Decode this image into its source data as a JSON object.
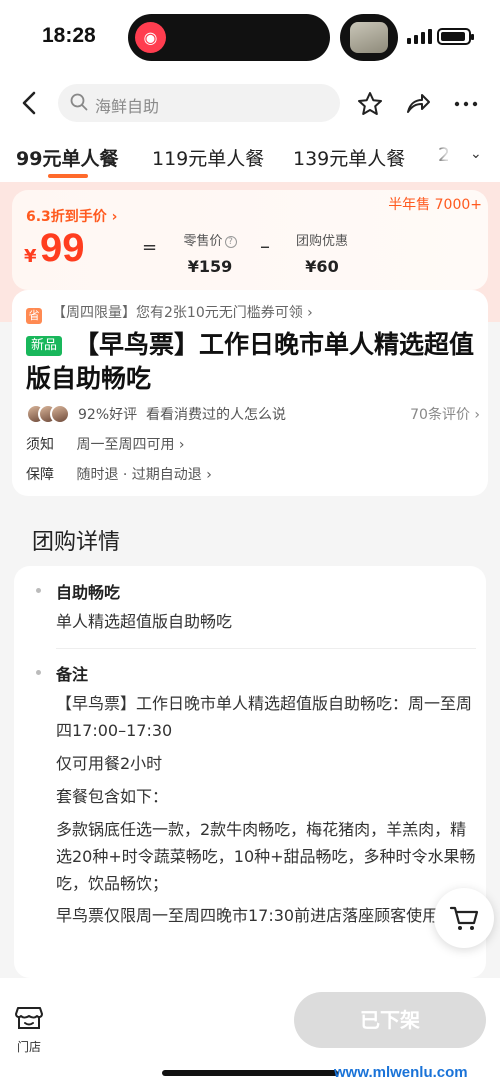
{
  "status_bar": {
    "time": "18:28"
  },
  "nav": {
    "search_placeholder": "海鲜自助"
  },
  "tabs": [
    {
      "label": "99元单人餐",
      "active": true
    },
    {
      "label": "119元单人餐",
      "active": false
    },
    {
      "label": "139元单人餐",
      "active": false
    },
    {
      "label": "2",
      "active": false
    }
  ],
  "price_card": {
    "discount": "6.3折到手价 ›",
    "half_year_sales": "半年售 7000+",
    "yen": "¥",
    "price": "99",
    "equals": "=",
    "retail_label": "零售价",
    "retail_value": "¥159",
    "minus": "–",
    "group_label": "团购优惠",
    "group_value": "¥60"
  },
  "info": {
    "coupon_icon": "省",
    "coupon": "【周四限量】您有2张10元无门槛券可领 ›",
    "new_badge": "新品",
    "title": "【早鸟票】工作日晚市单人精选超值版自助畅吃",
    "rating_pct": "92%好评",
    "rating_text": "看看消费过的人怎么说",
    "reviews": "70条评价 ›",
    "notice_key": "须知",
    "notice_value": "周一至周四可用 ›",
    "guarantee_key": "保障",
    "guarantee_value": "随时退 · 过期自动退 ›"
  },
  "detail": {
    "heading": "团购详情",
    "section1_title": "自助畅吃",
    "section1_text": "单人精选超值版自助畅吃",
    "section2_title": "备注",
    "note1": "【早鸟票】工作日晚市单人精选超值版自助畅吃：周一至周四17:00–17:30",
    "note2": "仅可用餐2小时",
    "note3": "套餐包含如下：",
    "note4": "多款锅底任选一款，2款牛肉畅吃，梅花猪肉，羊羔肉，精选20种+时令蔬菜畅吃，10种+甜品畅吃，多种时令水果畅吃，饮品畅饮；",
    "note5": "早鸟票仅限周一至周四晚市17:30前进店落座顾客使用"
  },
  "bottom": {
    "store_label": "门店",
    "offshelf_button": "已下架"
  },
  "watermark": "www.mlwenlu.com",
  "colors": {
    "accent": "#ff5a1f",
    "price": "#ff3d1f",
    "new_badge": "#19b75b"
  }
}
